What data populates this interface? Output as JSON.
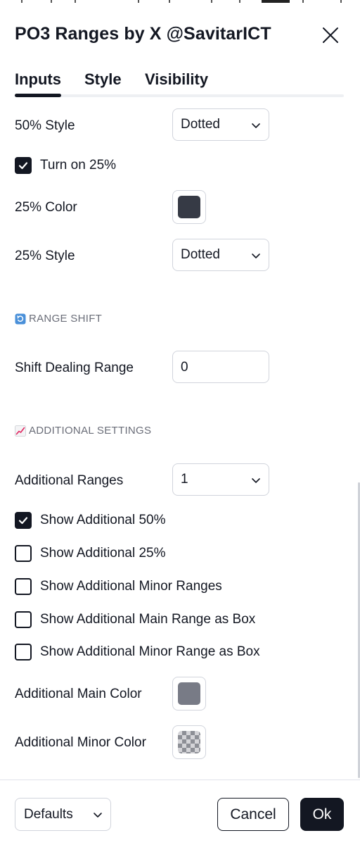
{
  "dialog": {
    "title": "PO3 Ranges by X @SavitarICT"
  },
  "tabs": [
    {
      "label": "Inputs",
      "active": true
    },
    {
      "label": "Style",
      "active": false
    },
    {
      "label": "Visibility",
      "active": false
    }
  ],
  "fields": {
    "style50": {
      "label": "50% Style",
      "value": "Dotted"
    },
    "turnOn25": {
      "label": "Turn on 25%",
      "checked": true
    },
    "color25": {
      "label": "25% Color",
      "color": "#363a45"
    },
    "style25": {
      "label": "25% Style",
      "value": "Dotted"
    }
  },
  "rangeShift": {
    "heading": "RANGE SHIFT",
    "icon": "arrows-counterclockwise-icon",
    "shiftDealingRange": {
      "label": "Shift Dealing Range",
      "value": "0"
    }
  },
  "additional": {
    "heading": "ADDITIONAL SETTINGS",
    "icon": "chart-increasing-icon",
    "additionalRanges": {
      "label": "Additional Ranges",
      "value": "1"
    },
    "checks": [
      {
        "label": "Show Additional 50%",
        "checked": true
      },
      {
        "label": "Show Additional 25%",
        "checked": false
      },
      {
        "label": "Show Additional Minor Ranges",
        "checked": false
      },
      {
        "label": "Show Additional Main Range as Box",
        "checked": false
      },
      {
        "label": "Show Additional Minor Range as Box",
        "checked": false
      }
    ],
    "mainColor": {
      "label": "Additional Main Color",
      "color": "#787b86"
    },
    "minorColor": {
      "label": "Additional Minor Color",
      "color": "transparent"
    }
  },
  "footer": {
    "defaults_label": "Defaults",
    "cancel_label": "Cancel",
    "ok_label": "Ok"
  },
  "colors": {
    "text": "#131722",
    "border": "#d1d4dc",
    "muted": "#6a6d78",
    "primary_button": "#131722"
  }
}
